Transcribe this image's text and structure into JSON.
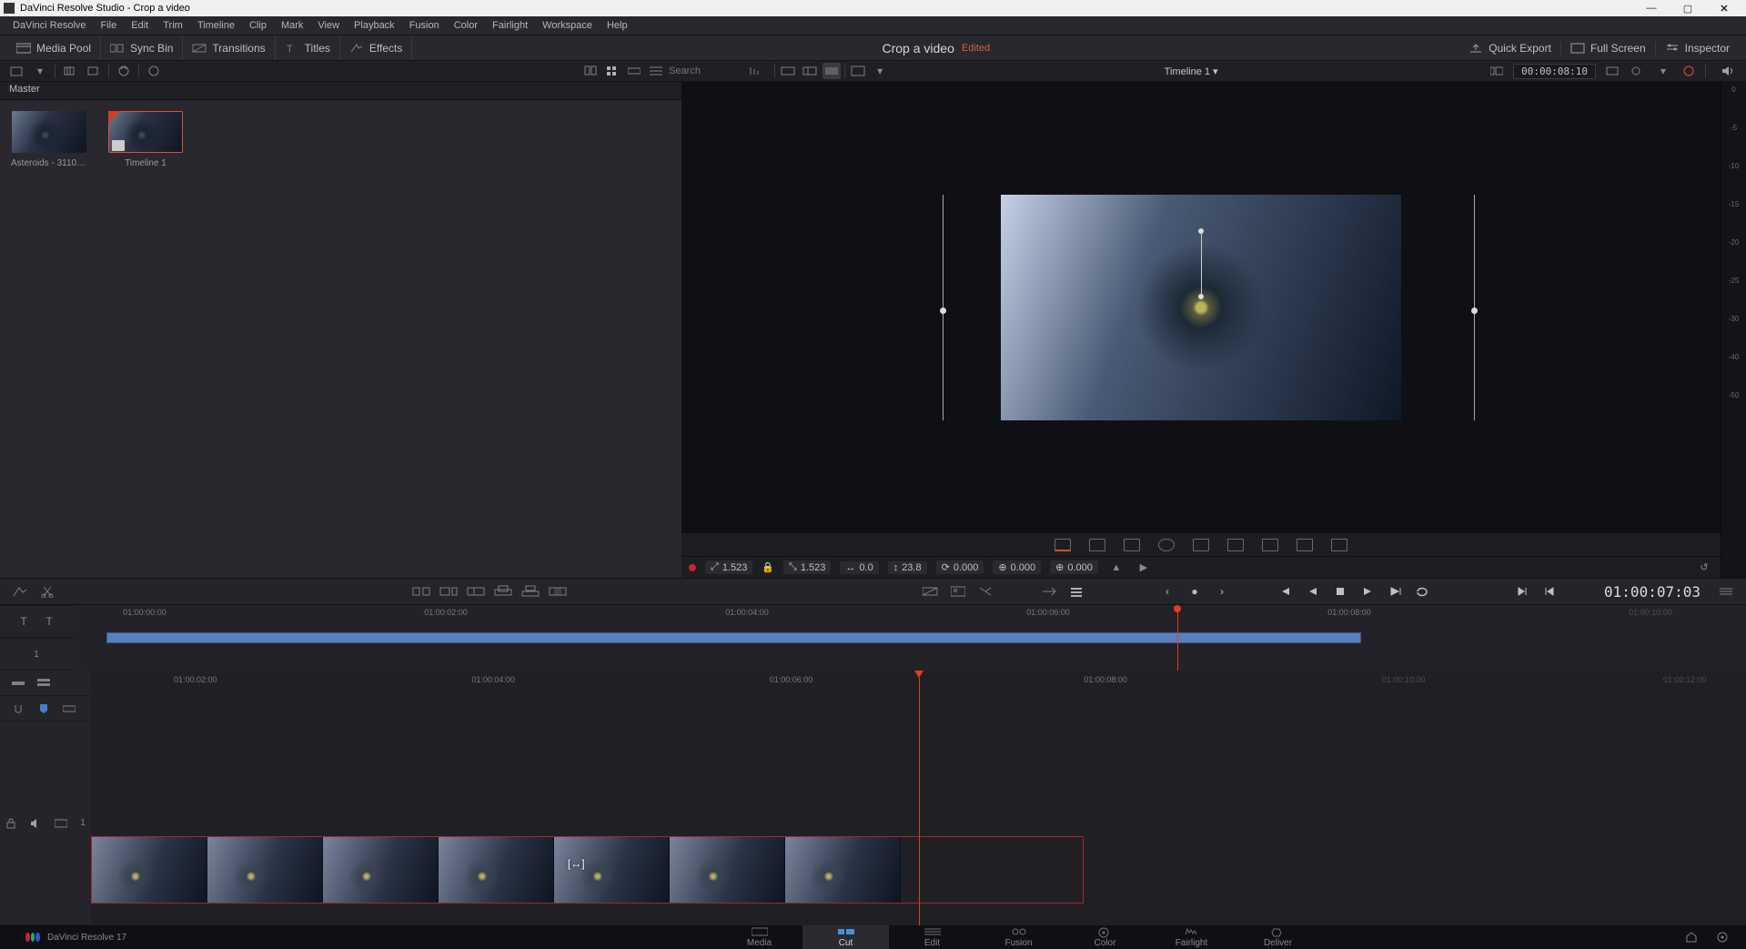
{
  "titlebar": {
    "title": "DaVinci Resolve Studio - Crop a video"
  },
  "menubar": [
    "DaVinci Resolve",
    "File",
    "Edit",
    "Trim",
    "Timeline",
    "Clip",
    "Mark",
    "View",
    "Playback",
    "Fusion",
    "Color",
    "Fairlight",
    "Workspace",
    "Help"
  ],
  "toolbar": {
    "media_pool": "Media Pool",
    "sync_bin": "Sync Bin",
    "transitions": "Transitions",
    "titles": "Titles",
    "effects": "Effects",
    "project_title": "Crop a video",
    "edited_badge": "Edited",
    "quick_export": "Quick Export",
    "full_screen": "Full Screen",
    "inspector": "Inspector"
  },
  "secondary": {
    "search_placeholder": "Search",
    "timeline_name": "Timeline 1",
    "tc_box": "00:00:08:10"
  },
  "media_pool": {
    "master": "Master",
    "clips": [
      {
        "name": "Asteroids - 31105...",
        "selected": false
      },
      {
        "name": "Timeline 1",
        "selected": true
      }
    ]
  },
  "viewer": {
    "meter_labels": [
      "0",
      "-5",
      "-10",
      "-15",
      "-20",
      "-25",
      "-30",
      "-40",
      "-50"
    ],
    "transform": {
      "zoom_x": "1.523",
      "zoom_y": "1.523",
      "pos_x": "0.0",
      "pos_y": "23.8",
      "rotation": "0.000",
      "anchor_x": "0.000",
      "anchor_y": "0.000"
    }
  },
  "playback": {
    "timecode": "01:00:07:03"
  },
  "mini_timeline": {
    "labels": [
      "01:00:00:00",
      "01:00:02:00",
      "01:00:04:00",
      "01:00:06:00",
      "01:00:08:00",
      "01:00:10:00"
    ],
    "track_num": "1"
  },
  "big_timeline": {
    "labels": [
      "01:00:02:00",
      "01:00:04:00",
      "01:00:06:00",
      "01:00:08:00",
      "01:00:10:00",
      "01:00:12:00"
    ],
    "track_num": "1"
  },
  "branding": {
    "version": "DaVinci Resolve 17"
  },
  "pages": [
    {
      "name": "Media"
    },
    {
      "name": "Cut",
      "active": true
    },
    {
      "name": "Edit"
    },
    {
      "name": "Fusion"
    },
    {
      "name": "Color"
    },
    {
      "name": "Fairlight"
    },
    {
      "name": "Deliver"
    }
  ]
}
